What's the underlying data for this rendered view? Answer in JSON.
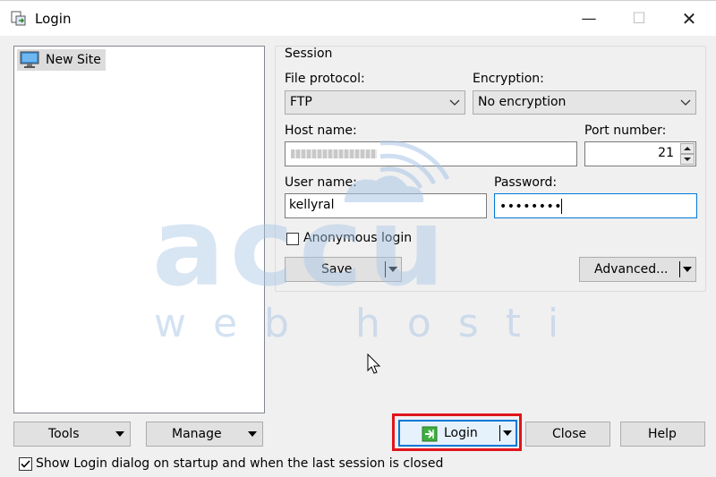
{
  "window": {
    "title": "Login",
    "minimize_glyph": "—",
    "maximize_glyph": "☐",
    "close_glyph": "✕"
  },
  "site_list": {
    "items": [
      {
        "label": "New Site",
        "icon": "computer-monitor-icon",
        "selected": true
      }
    ]
  },
  "session": {
    "group_label": "Session",
    "file_protocol": {
      "label": "File protocol:",
      "value": "FTP"
    },
    "encryption": {
      "label": "Encryption:",
      "value": "No encryption"
    },
    "host_name": {
      "label": "Host name:",
      "value": ""
    },
    "port_number": {
      "label": "Port number:",
      "value": "21"
    },
    "user_name": {
      "label": "User name:",
      "value": "kellyral"
    },
    "password": {
      "label": "Password:",
      "value": "••••••••"
    },
    "anonymous_login": {
      "label": "Anonymous login",
      "checked": false
    },
    "save_button": "Save",
    "advanced_button": "Advanced..."
  },
  "watermark": {
    "brand": "accu",
    "tagline": "web hosting"
  },
  "bottom_buttons": {
    "tools": "Tools",
    "manage": "Manage",
    "login": "Login",
    "close": "Close",
    "help": "Help"
  },
  "footer": {
    "show_login_checkbox": {
      "label": "Show Login dialog on startup and when the last session is closed",
      "checked": true
    }
  },
  "colors": {
    "accent": "#0078d7",
    "highlight_border": "#e0151b",
    "watermark": "#a9c6e6"
  }
}
